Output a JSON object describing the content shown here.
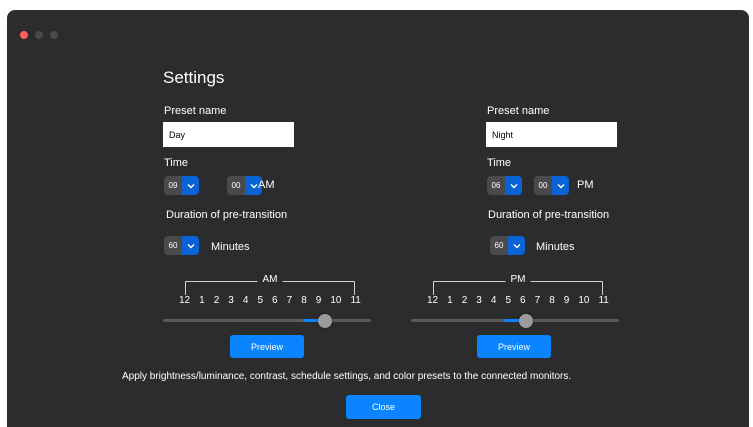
{
  "window": {
    "controls": [
      "close",
      "minimize",
      "zoom"
    ]
  },
  "page": {
    "title": "Settings"
  },
  "day": {
    "preset_label": "Preset name",
    "preset_value": "Day",
    "time_label": "Time",
    "hour": "09",
    "minute": "00",
    "meridiem": "AM",
    "duration_label": "Duration of pre-transition",
    "duration_value": "60",
    "duration_unit": "Minutes",
    "scale_label": "AM",
    "ticks": [
      "12",
      "1",
      "2",
      "3",
      "4",
      "5",
      "6",
      "7",
      "8",
      "9",
      "10",
      "11"
    ],
    "slider_value": 9,
    "preview_label": "Preview"
  },
  "night": {
    "preset_label": "Preset name",
    "preset_value": "Night",
    "time_label": "Time",
    "hour": "06",
    "minute": "00",
    "meridiem": "PM",
    "duration_label": "Duration of pre-transition",
    "duration_value": "60",
    "duration_unit": "Minutes",
    "scale_label": "PM",
    "ticks": [
      "12",
      "1",
      "2",
      "3",
      "4",
      "5",
      "6",
      "7",
      "8",
      "9",
      "10",
      "11"
    ],
    "slider_value": 6,
    "preview_label": "Preview"
  },
  "footer": {
    "note": "Apply brightness/luminance, contrast, schedule settings, and color presets to the connected monitors.",
    "close_label": "Close"
  },
  "colors": {
    "accent": "#0a84ff",
    "stepper_arrow": "#0a63d6",
    "background": "#2c2c2e"
  },
  "icons": {
    "stepper": "chevron-down-icon",
    "slider": "slider-thumb"
  }
}
